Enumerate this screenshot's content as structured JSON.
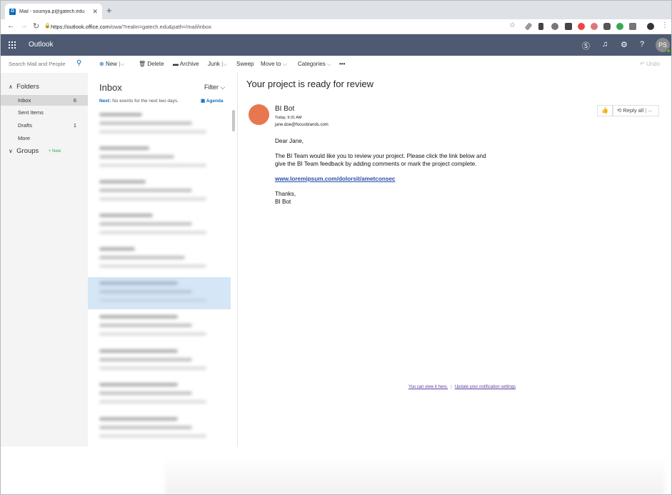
{
  "browser": {
    "tab_title": "Mail - soumya.p@gatech.edu",
    "tab_favicon": "O",
    "new_tab": "+",
    "url_host": "https://outlook.office.com",
    "url_path": "/owa/?realm=gatech.edu&path=/mail/inbox"
  },
  "suite": {
    "app_name": "Outlook",
    "avatar_initials": "PS"
  },
  "commands": {
    "search_placeholder": "Search Mail and People",
    "new": "New",
    "delete": "Delete",
    "archive": "Archive",
    "junk": "Junk",
    "sweep": "Sweep",
    "move_to": "Move to",
    "categories": "Categories",
    "more": "•••",
    "undo": "Undo"
  },
  "nav": {
    "folders_header": "Folders",
    "items": [
      {
        "label": "Inbox",
        "count": "6"
      },
      {
        "label": "Sent Items",
        "count": ""
      },
      {
        "label": "Drafts",
        "count": "1"
      },
      {
        "label": "More",
        "count": ""
      }
    ],
    "groups_header": "Groups",
    "groups_badge": "+ New"
  },
  "list": {
    "title": "Inbox",
    "filter": "Filter",
    "next_label": "Next:",
    "next_text": "No events for the next two days.",
    "agenda": "Agenda"
  },
  "message": {
    "subject": "Your project is ready for review",
    "sender_name": "BI Bot",
    "date": "Today, 9:31 AM",
    "to": "jane.doe@focusbrands.com",
    "reply_all": "Reply all",
    "greeting": "Dear Jane,",
    "line1": "The BI Team would like you to review your project. Please click the link below and",
    "line2": "give the BI Team feedback by adding comments or mark the project complete.",
    "link": "www.loremipsum.com/dolorsit/ametconsec",
    "closing": "Thanks,",
    "signature": "BI Bot",
    "footer_link1": "You can view it here.",
    "footer_sep": "|",
    "footer_link2": "Update your notification settings"
  },
  "colors": {
    "suite_bar": "#4d5a72",
    "accent": "#0f6cbd",
    "sender_avatar": "#e8774f",
    "selected_row": "#d5e6f7"
  }
}
